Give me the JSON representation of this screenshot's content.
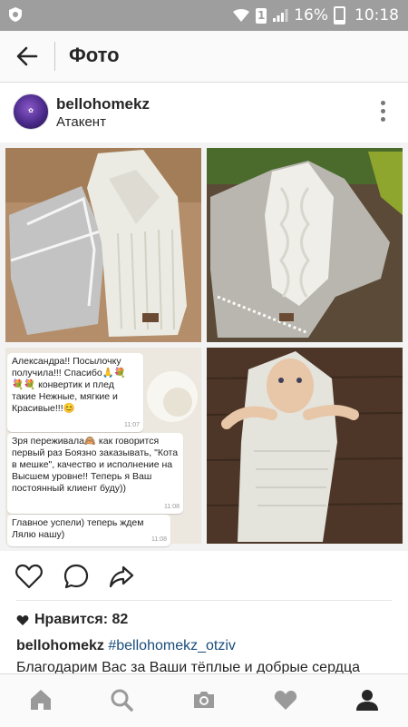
{
  "status_bar": {
    "battery": "16%",
    "time": "10:18",
    "sim": "1"
  },
  "header": {
    "title": "Фото"
  },
  "post": {
    "username": "bellohomekz",
    "location": "Атакент",
    "chat_messages": [
      {
        "text": "Александра!! Посылочку получила!!! Спасибо🙏💐 💐💐 конвертик и плед такие Нежные, мягкие и Красивые!!!😊",
        "time": "11:07"
      },
      {
        "text": "Зря переживала🙈 как говорится первый раз Боязно заказывать, \"Кота в мешке\", качество и исполнение на Высшем уровне!! Теперь я Ваш постоянный клиент буду))",
        "time": "11:08"
      },
      {
        "text": "Главное успели) теперь ждем Лялю нашу)",
        "time": "11:08"
      }
    ],
    "likes_label": "Нравится: 82",
    "caption_user": "bellohomekz",
    "caption_tag": "#bellohomekz_otziv",
    "caption_text": "Благодарим Вас за Ваши тёплые и добрые сердца"
  },
  "colors": {
    "status_bar": "#9e9e9e",
    "hashtag": "#1a4d7c"
  }
}
